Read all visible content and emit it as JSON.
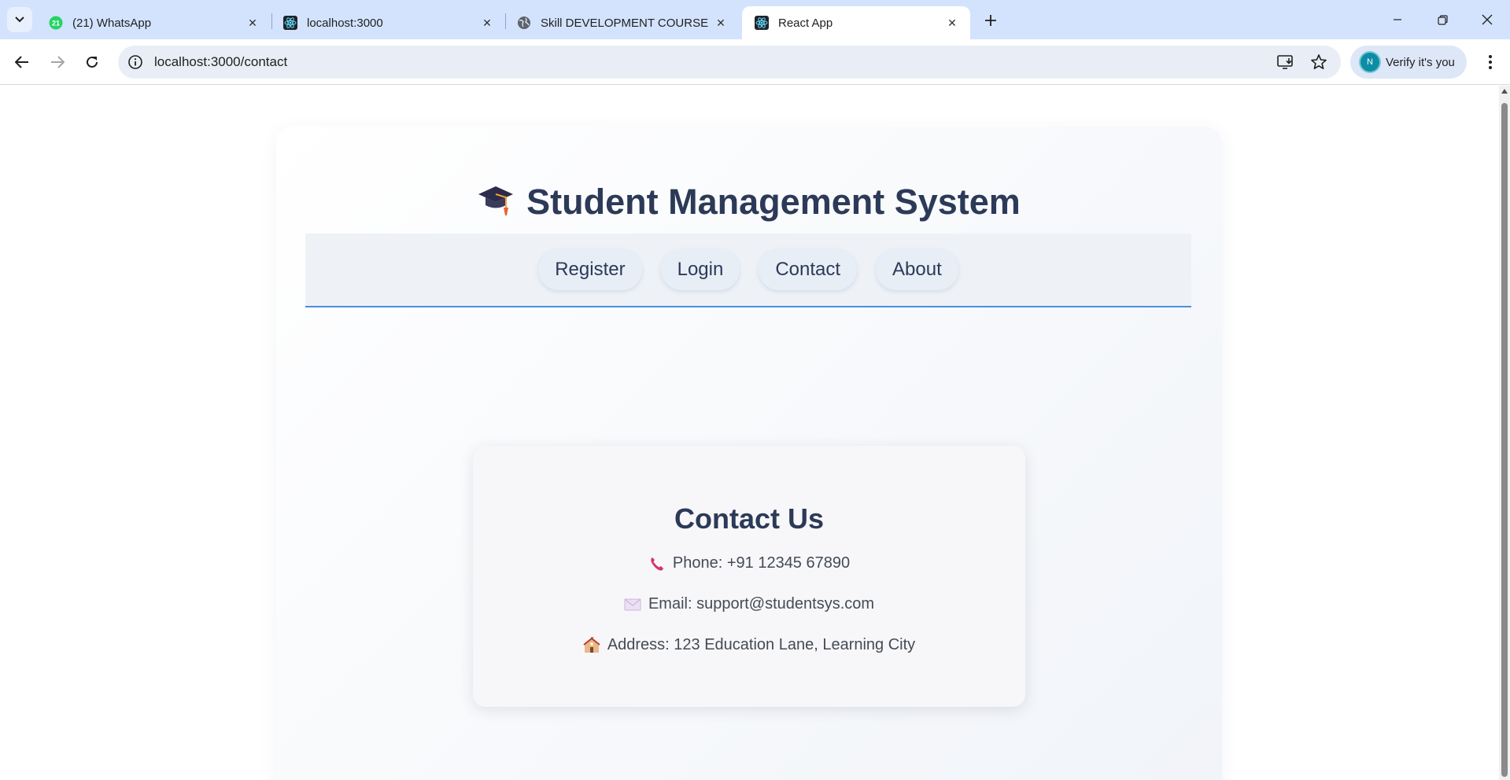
{
  "browser": {
    "tabs": [
      {
        "title": "(21) WhatsApp",
        "icon": "whatsapp-icon",
        "badge": "21",
        "active": false
      },
      {
        "title": "localhost:3000",
        "icon": "react-icon",
        "active": false
      },
      {
        "title": "Skill DEVELOPMENT COURSE",
        "icon": "globe-icon",
        "active": false
      },
      {
        "title": "React App",
        "icon": "react-icon",
        "active": true
      }
    ],
    "url": "localhost:3000/contact",
    "profile_initial": "N",
    "verify_label": "Verify it's you",
    "colors": {
      "tabstrip": "#d3e3fd",
      "omnibox": "#e9eef6",
      "accent": "#0b57d0"
    }
  },
  "app": {
    "title": "Student Management System",
    "title_icon": "graduation-cap-icon",
    "nav": [
      {
        "label": "Register"
      },
      {
        "label": "Login"
      },
      {
        "label": "Contact"
      },
      {
        "label": "About"
      }
    ],
    "colors": {
      "heading": "#2c3a58",
      "nav_underline": "#4f8ed9"
    }
  },
  "contact": {
    "title": "Contact Us",
    "phone": "Phone: +91 12345 67890",
    "email": "Email: support@studentsys.com",
    "address": "Address: 123 Education Lane, Learning City",
    "icons": [
      "phone-icon",
      "envelope-icon",
      "school-icon"
    ]
  }
}
